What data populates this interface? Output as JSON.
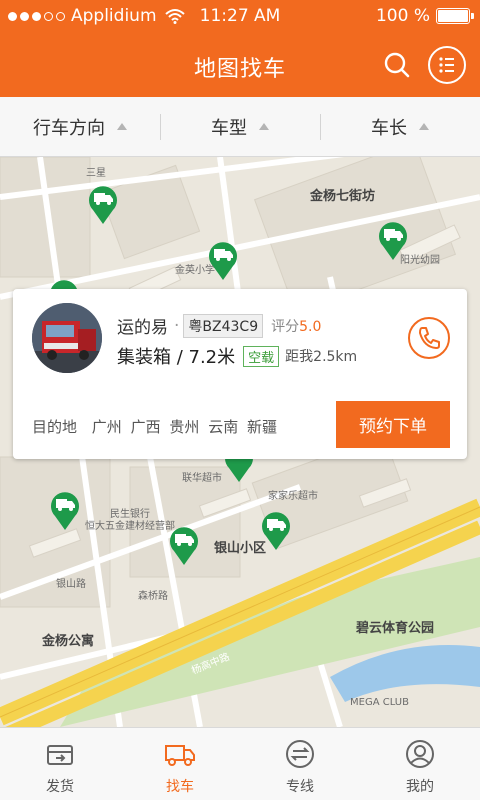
{
  "status_bar": {
    "carrier": "Applidium",
    "time": "11:27 AM",
    "battery": "100 %"
  },
  "header": {
    "title": "地图找车",
    "search_icon": "search-icon",
    "menu_icon": "list-menu-icon"
  },
  "filters": [
    {
      "label": "行车方向"
    },
    {
      "label": "车型"
    },
    {
      "label": "车长"
    }
  ],
  "map": {
    "labels": [
      "金杨七街坊",
      "银山小区",
      "碧云体育公园",
      "金杨公寓",
      "杨高中路",
      "联华超市",
      "民生银行",
      "家家乐超市",
      "恒大五金建材经营部",
      "MEGA CLUB",
      "三星",
      "金英小学",
      "阳光幼园",
      "银山路",
      "森桥路"
    ],
    "truck_pin_color": "#1e9a4a"
  },
  "card": {
    "driver_name": "运的易",
    "separator": "·",
    "plate": "粤BZ43C9",
    "rating_label": "评分",
    "rating_value": "5.0",
    "vehicle": "集装箱 / 7.2米",
    "status_tag": "空载",
    "distance": "距我2.5km",
    "destination_label": "目的地",
    "destinations": [
      "广州",
      "广西",
      "贵州",
      "云南",
      "新疆"
    ],
    "book_button": "预约下单"
  },
  "tabs": [
    {
      "label": "发货",
      "icon": "shipment-icon",
      "active": false
    },
    {
      "label": "找车",
      "icon": "truck-icon",
      "active": true
    },
    {
      "label": "专线",
      "icon": "route-icon",
      "active": false
    },
    {
      "label": "我的",
      "icon": "profile-icon",
      "active": false
    }
  ],
  "colors": {
    "accent": "#f26a1f",
    "map_green": "#1e9a4a"
  }
}
